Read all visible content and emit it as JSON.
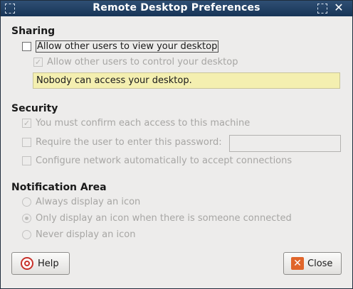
{
  "window": {
    "title": "Remote Desktop Preferences"
  },
  "sharing": {
    "heading": "Sharing",
    "allow_view": {
      "label": "Allow other users to view your desktop",
      "checked": false
    },
    "allow_control": {
      "label": "Allow other users to control your desktop",
      "checked": true,
      "enabled": false
    },
    "info": "Nobody can access your desktop."
  },
  "security": {
    "heading": "Security",
    "confirm": {
      "label": "You must confirm each access to this machine",
      "checked": true,
      "enabled": false
    },
    "require_password": {
      "label": "Require the user to enter this password:",
      "checked": false,
      "enabled": false
    },
    "password_value": "",
    "configure_network": {
      "label": "Configure network automatically to accept connections",
      "checked": false,
      "enabled": false
    }
  },
  "notification": {
    "heading": "Notification Area",
    "options": [
      {
        "label": "Always display an icon",
        "selected": false
      },
      {
        "label": "Only display an icon when there is someone connected",
        "selected": true
      },
      {
        "label": "Never display an icon",
        "selected": false
      }
    ]
  },
  "buttons": {
    "help": "Help",
    "close": "Close"
  }
}
